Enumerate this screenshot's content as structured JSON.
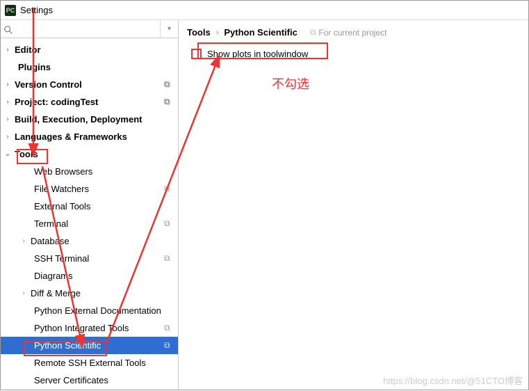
{
  "titlebar": {
    "app_icon": "PC",
    "title": "Settings"
  },
  "search": {
    "placeholder": ""
  },
  "tree": {
    "editor": "Editor",
    "plugins": "Plugins",
    "version_control": "Version Control",
    "project": "Project: codingTest",
    "build": "Build, Execution, Deployment",
    "lang_fw": "Languages & Frameworks",
    "tools": "Tools",
    "web_browsers": "Web Browsers",
    "file_watchers": "File Watchers",
    "external_tools": "External Tools",
    "terminal": "Terminal",
    "database": "Database",
    "ssh_terminal": "SSH Terminal",
    "diagrams": "Diagrams",
    "diff_merge": "Diff & Merge",
    "py_ext_doc": "Python External Documentation",
    "py_int_tools": "Python Integrated Tools",
    "py_sci": "Python Scientific",
    "remote_ssh": "Remote SSH External Tools",
    "server_certs": "Server Certificates"
  },
  "breadcrumb": {
    "p1": "Tools",
    "p2": "Python Scientific",
    "scope": "For current project"
  },
  "options": {
    "show_plots": "Show plots in toolwindow"
  },
  "annotation": {
    "no_check": "不勾选"
  },
  "watermark": "https://blog.csdn.net/@51CTO博客"
}
